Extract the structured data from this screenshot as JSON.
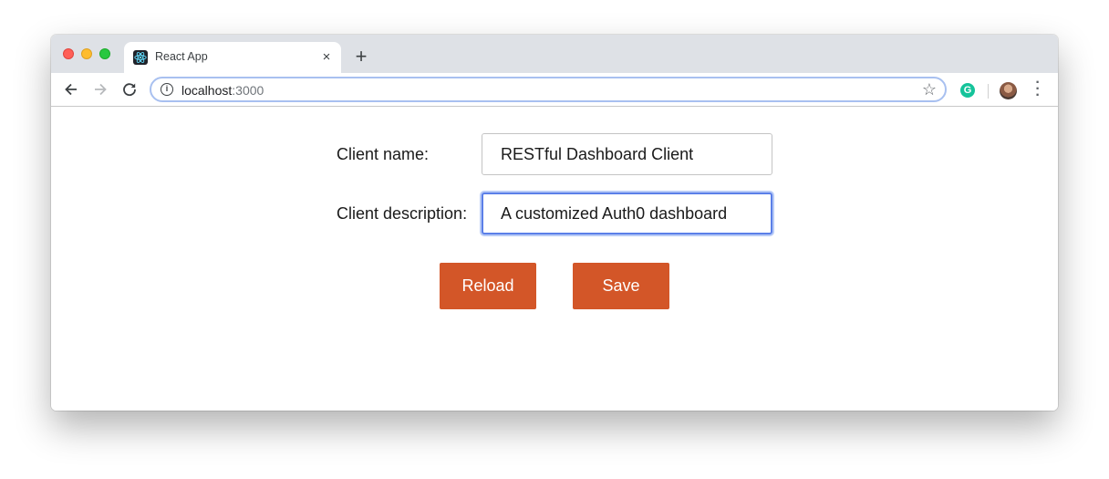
{
  "browser": {
    "tab_title": "React App",
    "tab_close": "×",
    "new_tab": "+",
    "url_host": "localhost",
    "url_port": ":3000",
    "extension_letter": "G",
    "icons": {
      "back": "arrow-left-icon",
      "forward": "arrow-right-icon",
      "reload": "reload-icon",
      "info": "info-icon",
      "bookmark": "star-icon",
      "menu": "kebab-menu-icon",
      "favicon": "react-logo-icon"
    }
  },
  "form": {
    "client_name_label": "Client name:",
    "client_name_value": "RESTful Dashboard Client",
    "client_description_label": "Client description:",
    "client_description_value": "A customized Auth0 dashboard"
  },
  "buttons": {
    "reload_label": "Reload",
    "save_label": "Save"
  },
  "colors": {
    "accent_button": "#d35628",
    "focus_ring": "#5b7fe8",
    "tabstrip": "#dee1e6"
  }
}
